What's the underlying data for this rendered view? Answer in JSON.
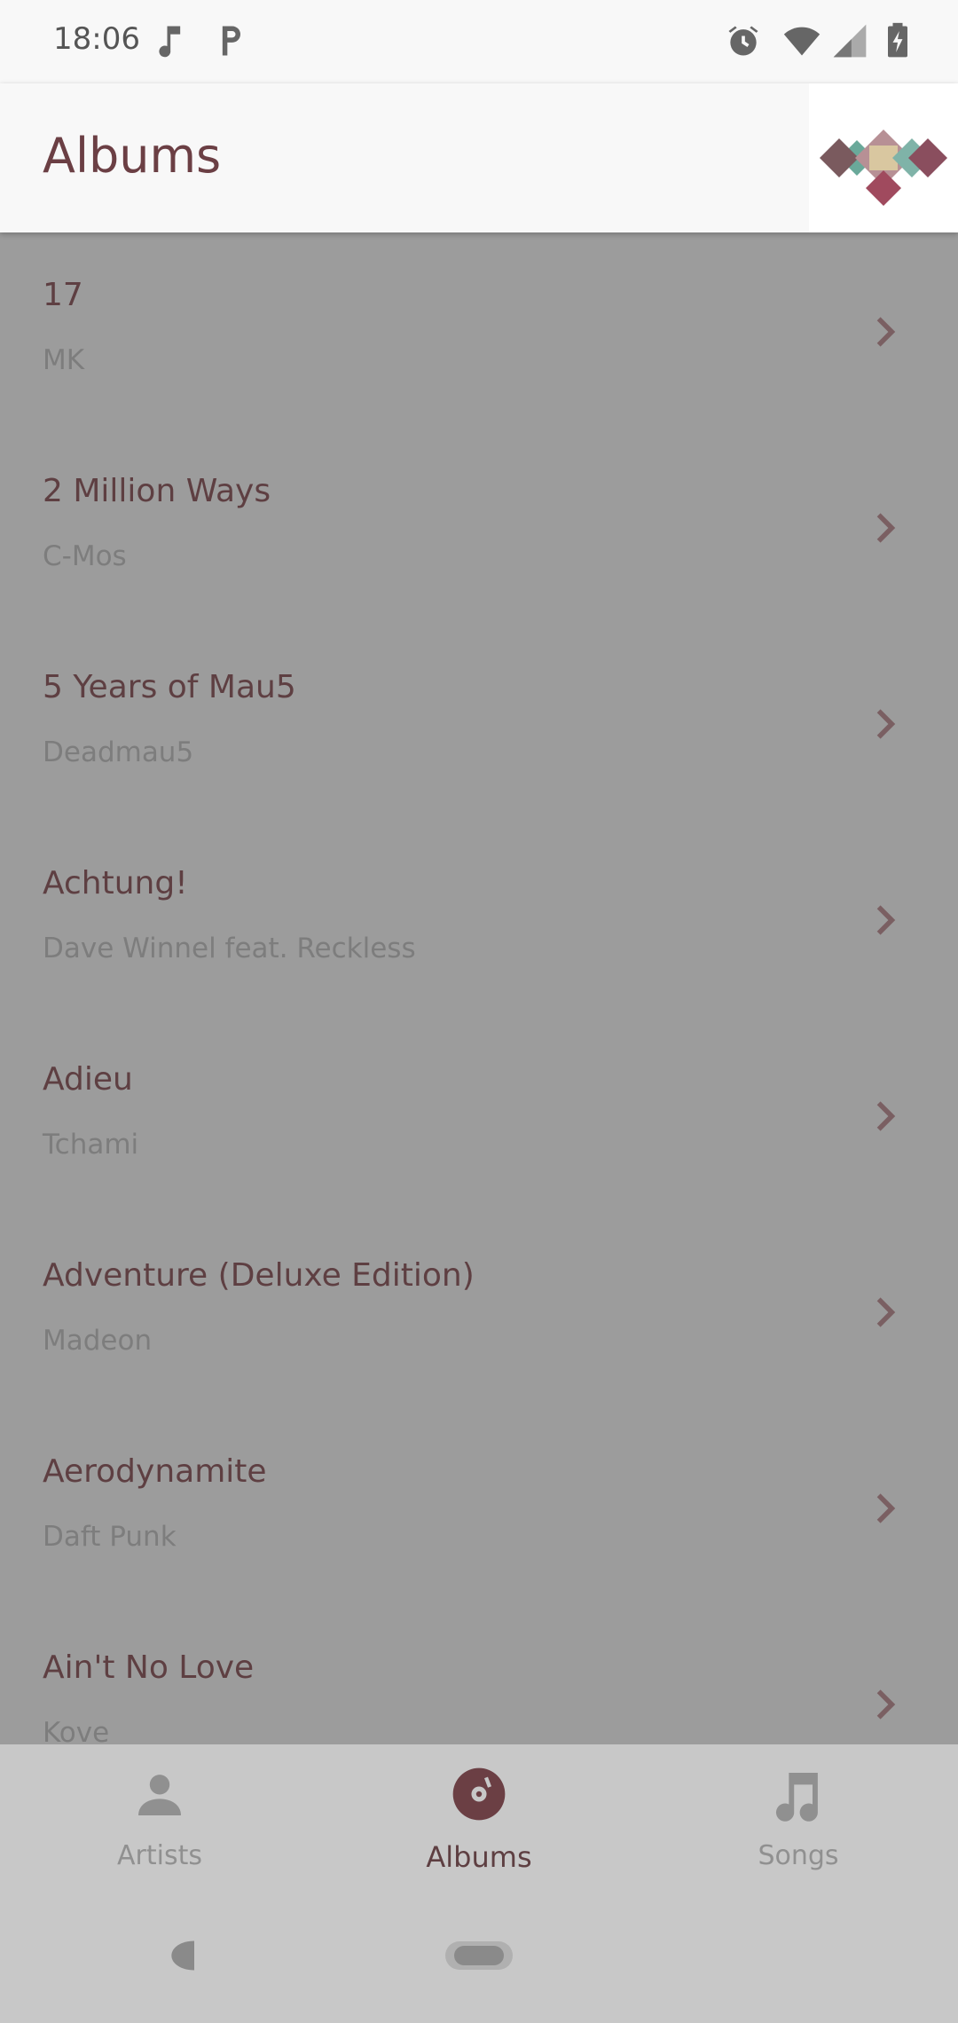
{
  "status_bar": {
    "time": "18:06",
    "left_icons": [
      "music-note-icon",
      "parking-icon"
    ],
    "right_icons": [
      "alarm-icon",
      "wifi-icon",
      "signal-icon",
      "battery-charging-icon"
    ]
  },
  "app_bar": {
    "title": "Albums",
    "logo": "app-logo"
  },
  "albums": [
    {
      "title": "17",
      "artist": "MK"
    },
    {
      "title": "2 Million Ways",
      "artist": "C-Mos"
    },
    {
      "title": "5 Years of Mau5",
      "artist": "Deadmau5"
    },
    {
      "title": "Achtung!",
      "artist": "Dave Winnel feat. Reckless"
    },
    {
      "title": "Adieu",
      "artist": "Tchami"
    },
    {
      "title": "Adventure (Deluxe Edition)",
      "artist": "Madeon"
    },
    {
      "title": "Aerodynamite",
      "artist": "Daft Punk"
    },
    {
      "title": "Ain't No Love",
      "artist": "Kove"
    }
  ],
  "bottom_nav": {
    "items": [
      {
        "label": "Artists",
        "icon": "person-icon",
        "active": false
      },
      {
        "label": "Albums",
        "icon": "album-disc-icon",
        "active": true
      },
      {
        "label": "Songs",
        "icon": "music-note-icon",
        "active": false
      }
    ]
  },
  "colors": {
    "accent": "#5e3f42",
    "title": "#6b3f44",
    "scrim_bg": "#9c9c9c",
    "bar_bg": "#f8f8f8",
    "nav_bg": "#c8c8c8"
  }
}
